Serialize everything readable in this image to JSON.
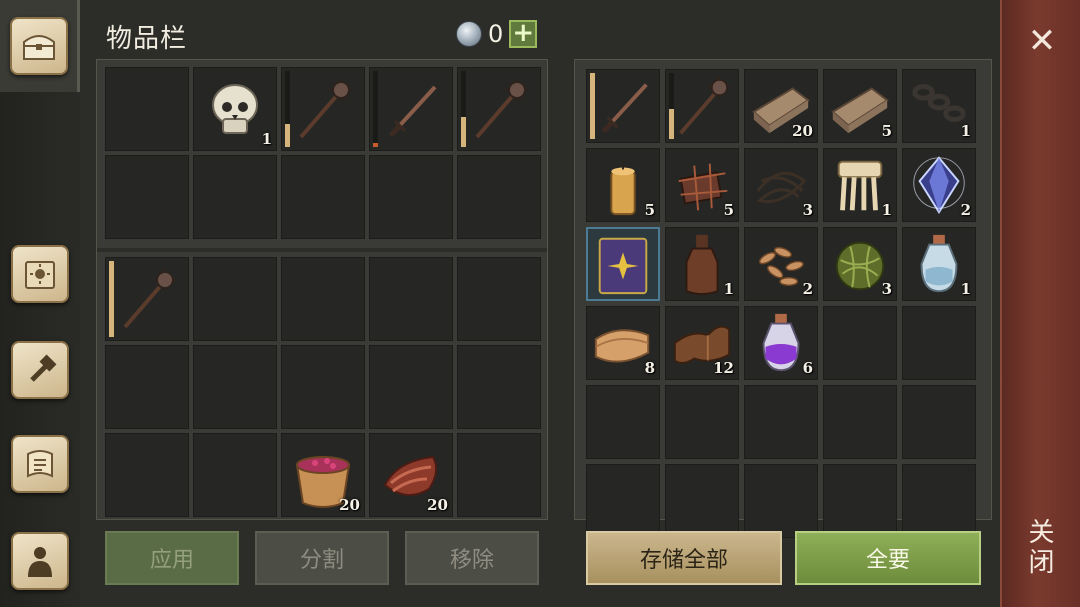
{
  "header": {
    "title": "物品栏",
    "currency_count": "0",
    "add_label": "+"
  },
  "rail": {
    "tabs": [
      {
        "name": "chest-icon",
        "active": true
      },
      {
        "name": "crafting-book-icon",
        "active": false
      },
      {
        "name": "build-hammer-icon",
        "active": false
      },
      {
        "name": "quest-scroll-icon",
        "active": false
      },
      {
        "name": "character-icon",
        "active": false
      }
    ]
  },
  "inventory": {
    "top_grid": [
      {},
      {
        "icon": "skull-icon",
        "qty": "1"
      },
      {
        "icon": "mace-icon",
        "durability": 0.3
      },
      {
        "icon": "sword-icon",
        "durability": 0.05,
        "low": true
      },
      {
        "icon": "mace-icon",
        "durability": 0.4
      },
      {},
      {},
      {},
      {},
      {}
    ],
    "bottom_grid": [
      {
        "icon": "mace-icon",
        "durability": 1.0
      },
      {},
      {},
      {},
      {},
      {},
      {},
      {},
      {},
      {},
      {},
      {},
      {
        "icon": "berry-bowl-icon",
        "qty": "20"
      },
      {
        "icon": "raw-meat-icon",
        "qty": "20"
      },
      {}
    ],
    "buttons": {
      "apply": "应用",
      "split": "分割",
      "remove": "移除"
    }
  },
  "storage": {
    "grid": [
      {
        "icon": "sword-icon",
        "durability": 1.0
      },
      {
        "icon": "mace-icon",
        "durability": 0.45
      },
      {
        "icon": "plank-icon",
        "qty": "20"
      },
      {
        "icon": "plank-icon",
        "qty": "5"
      },
      {
        "icon": "chain-icon",
        "qty": "1"
      },
      {
        "icon": "candle-icon",
        "qty": "5"
      },
      {
        "icon": "scrap-pile-icon",
        "qty": "5"
      },
      {
        "icon": "rope-icon",
        "qty": "3"
      },
      {
        "icon": "comb-icon",
        "qty": "1"
      },
      {
        "icon": "crystal-icon",
        "qty": "2"
      },
      {
        "icon": "magic-book-icon",
        "selected": true
      },
      {
        "icon": "bottle-icon",
        "qty": "1"
      },
      {
        "icon": "seeds-icon",
        "qty": "2"
      },
      {
        "icon": "plant-fiber-ball-icon",
        "qty": "3"
      },
      {
        "icon": "water-flask-icon",
        "qty": "1"
      },
      {
        "icon": "cloth-icon",
        "qty": "8"
      },
      {
        "icon": "leather-icon",
        "qty": "12"
      },
      {
        "icon": "purple-potion-icon",
        "qty": "6"
      },
      {},
      {},
      {},
      {},
      {},
      {},
      {},
      {},
      {},
      {},
      {},
      {}
    ],
    "buttons": {
      "store_all": "存储全部",
      "take_all": "全要"
    }
  },
  "close": {
    "label": "关闭"
  },
  "colors": {
    "accent_green": "#7f9e4a",
    "close_red": "#6e3228",
    "durability": "#d6b57c"
  }
}
